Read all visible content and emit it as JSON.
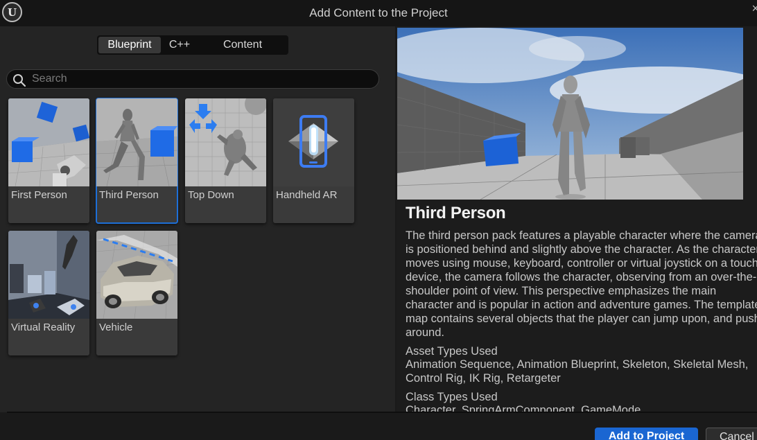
{
  "window": {
    "title": "Add Content to the Project",
    "close_label": "×"
  },
  "tabs": [
    {
      "label": "Blueprint",
      "active": true
    },
    {
      "label": "C++",
      "active": false
    },
    {
      "label": "Content",
      "active": false
    }
  ],
  "search": {
    "placeholder": "Search",
    "value": ""
  },
  "templates": [
    {
      "label": "First Person",
      "selected": false
    },
    {
      "label": "Third Person",
      "selected": true
    },
    {
      "label": "Top Down",
      "selected": false
    },
    {
      "label": "Handheld AR",
      "selected": false
    },
    {
      "label": "Virtual Reality",
      "selected": false
    },
    {
      "label": "Vehicle",
      "selected": false
    }
  ],
  "detail": {
    "title": "Third Person",
    "description": "The third person pack features a playable character where the camera is positioned behind and slightly above the character. As the character moves using mouse, keyboard, controller or virtual joystick on a touch device, the camera follows the character, observing from an over-the-shoulder point of view. This perspective emphasizes the main character and is popular in action and adventure games. The template map contains several objects that the player can jump upon, and push around.",
    "asset_types_heading": "Asset Types Used",
    "asset_types_value": "Animation Sequence, Animation Blueprint, Skeleton, Skeletal Mesh,\nControl Rig, IK Rig, Retargeter",
    "class_types_heading": "Class Types Used",
    "class_types_value": "Character, SpringArmComponent, GameMode"
  },
  "footer": {
    "primary_label": "Add to Project",
    "secondary_label": "Cancel"
  },
  "colors": {
    "accent": "#1a66d2",
    "selection_outline": "#1d6fd8",
    "panel": "#242424",
    "background": "#1a1a1a"
  }
}
